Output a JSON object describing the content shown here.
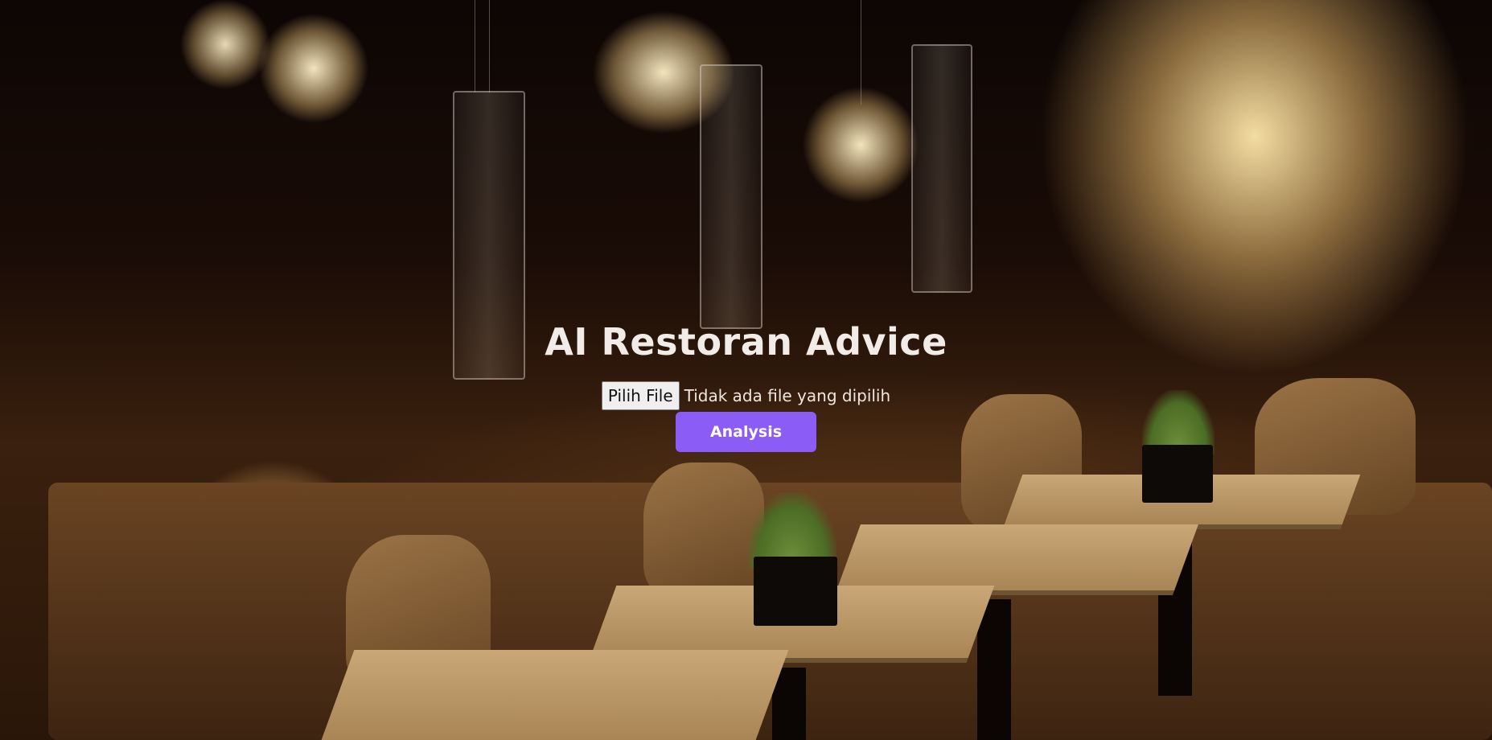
{
  "page": {
    "title": "AI Restoran Advice"
  },
  "upload": {
    "choose_file_label": "Pilih File",
    "no_file_text": "Tidak ada file yang dipilih"
  },
  "actions": {
    "analysis_label": "Analysis"
  },
  "colors": {
    "accent": "#8b5cf6",
    "title_text": "#f1ece7"
  },
  "background": {
    "description_icon": "restaurant-interior-photo"
  }
}
